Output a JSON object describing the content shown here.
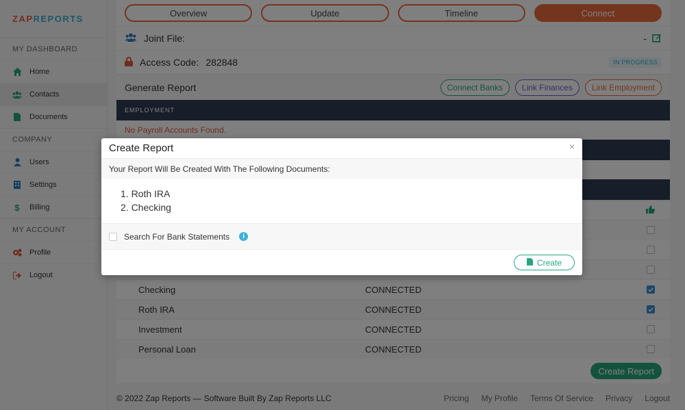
{
  "brand": {
    "part1": "ZAP",
    "part2": "REPORTS"
  },
  "sidebar": {
    "sections": [
      {
        "title": "MY DASHBOARD",
        "items": [
          {
            "label": "Home",
            "icon": "home-icon"
          },
          {
            "label": "Contacts",
            "icon": "users-icon",
            "active": true
          },
          {
            "label": "Documents",
            "icon": "document-icon"
          }
        ]
      },
      {
        "title": "COMPANY",
        "items": [
          {
            "label": "Users",
            "icon": "user-icon"
          },
          {
            "label": "Settings",
            "icon": "building-icon"
          },
          {
            "label": "Billing",
            "icon": "dollar-icon"
          }
        ]
      },
      {
        "title": "MY ACCOUNT",
        "items": [
          {
            "label": "Profile",
            "icon": "gears-icon"
          },
          {
            "label": "Logout",
            "icon": "logout-icon"
          }
        ]
      }
    ]
  },
  "tabs": [
    "Overview",
    "Update",
    "Timeline",
    "Connect"
  ],
  "joint_file": {
    "label": "Joint File:",
    "value": "-"
  },
  "access": {
    "label": "Access Code:",
    "value": "282848",
    "status": "IN PROGRESS"
  },
  "generate": {
    "title": "Generate Report",
    "buttons": [
      "Connect Banks",
      "Link Finances",
      "Link Employment"
    ]
  },
  "employment": {
    "header": "EMPLOYMENT",
    "warning": "No Payroll Accounts Found."
  },
  "accounts": [
    {
      "name": "Checking",
      "status": "CONNECTED",
      "checked": true
    },
    {
      "name": "Roth IRA",
      "status": "CONNECTED",
      "checked": true
    },
    {
      "name": "Investment",
      "status": "CONNECTED",
      "checked": false
    },
    {
      "name": "Personal Loan",
      "status": "CONNECTED",
      "checked": false
    }
  ],
  "create_report_label": "Create Report",
  "footer": {
    "copyright": "© 2022 Zap Reports —",
    "built_by": "Software Built By Zap Reports LLC",
    "links": [
      "Pricing",
      "My Profile",
      "Terms Of Service",
      "Privacy",
      "Logout"
    ]
  },
  "modal": {
    "title": "Create Report",
    "close": "×",
    "subtitle": "Your Report Will Be Created With The Following Documents:",
    "documents": [
      "1. Roth IRA",
      "2. Checking"
    ],
    "option_label": "Search For Bank Statements",
    "create_label": "Create"
  },
  "colors": {
    "accent": "#e86a3e",
    "green": "#27a77a",
    "navy": "#2f3b52",
    "purple": "#6a5fc7"
  }
}
